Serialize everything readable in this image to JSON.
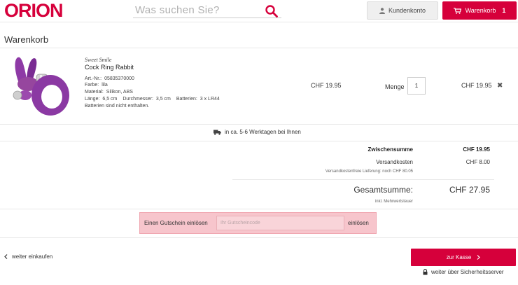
{
  "header": {
    "logo": "ORION",
    "search_placeholder": "Was suchen Sie?",
    "account_label": "Kundenkonto",
    "cart_label": "Warenkorb",
    "cart_count": "1"
  },
  "page": {
    "title": "Warenkorb"
  },
  "product": {
    "brand": "Sweet Smile",
    "name": "Cock Ring Rabbit",
    "article_label": "Art.-Nr.:",
    "article_value": "05835370000",
    "color_label": "Farbe:",
    "color_value": "lila",
    "material_label": "Material:",
    "material_value": "Silikon, ABS",
    "length_label": "Länge:",
    "length_value": "6,5 cm",
    "diameter_label": "Durchmesser:",
    "diameter_value": "3,5 cm",
    "battery_label": "Batterien:",
    "battery_value": "3 x LR44",
    "battery_note": "Batterien sind nicht enthalten.",
    "price": "CHF 19.95",
    "qty_label": "Menge",
    "qty_value": "1",
    "total": "CHF 19.95"
  },
  "delivery": {
    "text": "in ca. 5-6 Werktagen bei Ihnen"
  },
  "summary": {
    "subtotal_label": "Zwischensumme",
    "subtotal_value": "CHF 19.95",
    "shipping_label": "Versandkosten",
    "shipping_value": "CHF 8.00",
    "free_shipping_note": "Versandkostenfreie Lieferung: noch CHF 80.05",
    "total_label": "Gesamtsumme:",
    "total_value": "CHF 27.95",
    "vat_note": "inkl. Mehrwertsteuer"
  },
  "coupon": {
    "label": "Einen Gutschein einlösen",
    "placeholder": "Ihr Gutscheincode",
    "button": "einlösen"
  },
  "footer": {
    "back_link": "weiter einkaufen",
    "checkout_button": "zur Kasse",
    "secure_note": "weiter über Sicherheitsserver"
  },
  "colors": {
    "brand": "#d6003b",
    "coupon_highlight": "#f7c5cc"
  },
  "icons": [
    "search-icon",
    "user-icon",
    "cart-icon",
    "close-icon",
    "truck-icon",
    "chevron-left-icon",
    "chevron-right-icon",
    "lock-icon"
  ]
}
